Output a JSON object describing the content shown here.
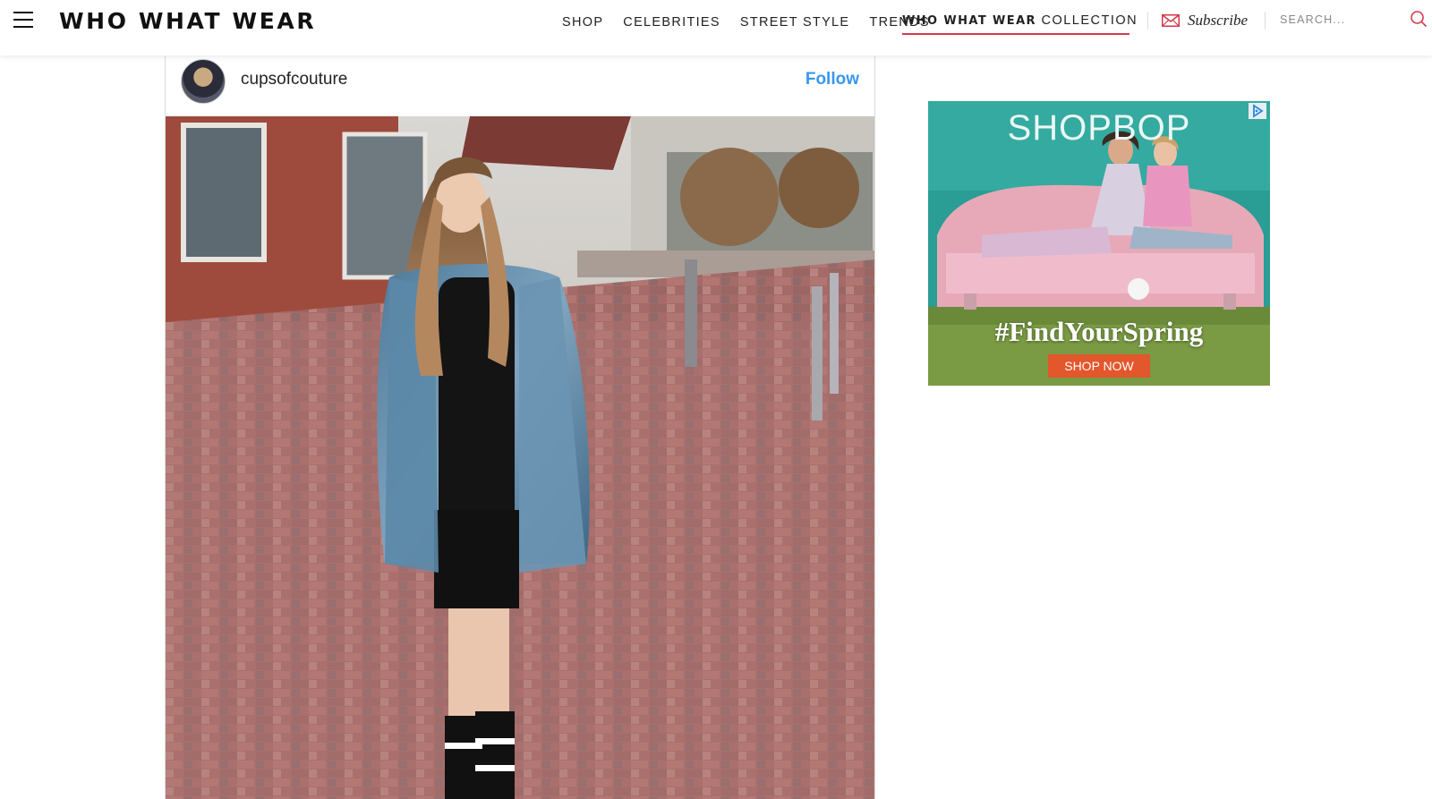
{
  "header": {
    "logo": "WHO WHAT WEAR",
    "nav": [
      {
        "label": "SHOP"
      },
      {
        "label": "CELEBRITIES"
      },
      {
        "label": "STREET STYLE"
      },
      {
        "label": "TRENDS"
      }
    ],
    "collection_brand": "WHO WHAT WEAR",
    "collection_suffix": "COLLECTION",
    "subscribe_label": "Subscribe",
    "search_placeholder": "SEARCH..."
  },
  "instagram_post": {
    "username": "cupsofcouture",
    "follow_label": "Follow"
  },
  "ad": {
    "brand": "SHOPBOP",
    "tagline": "#FindYourSpring",
    "cta": "SHOP NOW"
  },
  "colors": {
    "accent_red": "#d23a4b",
    "follow_blue": "#3897f0",
    "ad_cta": "#e2572b",
    "ad_teal": "#2a9d94"
  }
}
